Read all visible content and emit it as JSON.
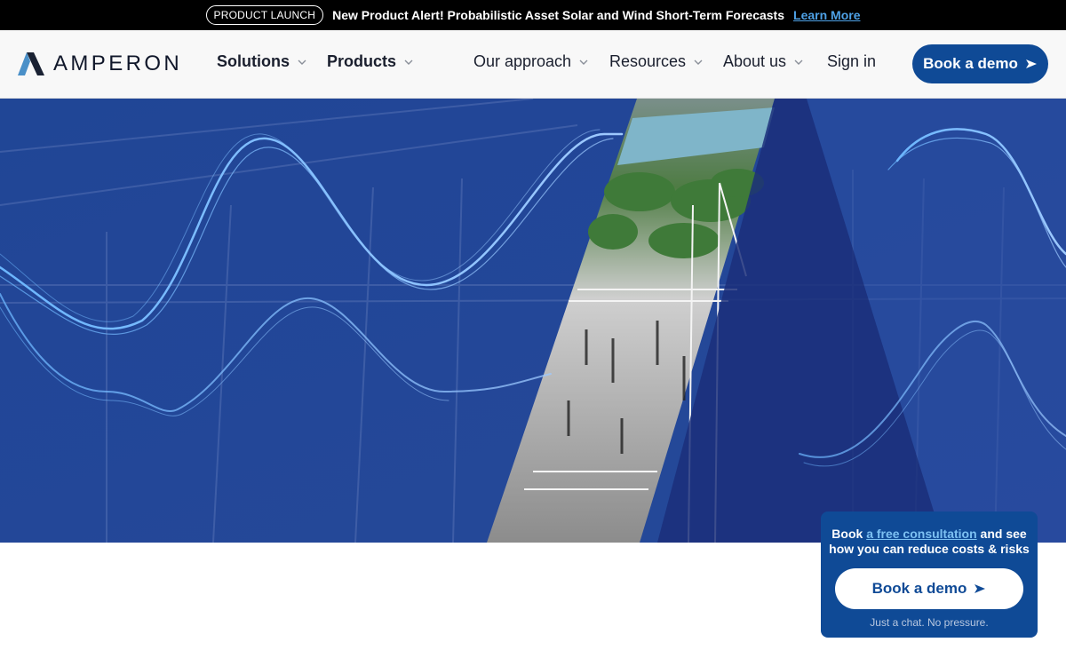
{
  "announcement": {
    "badge": "PRODUCT LAUNCH",
    "message": "New Product Alert! Probabilistic Asset Solar and Wind Short-Term Forecasts",
    "link": "Learn More"
  },
  "brand": {
    "name": "AMPERON",
    "logo_icon": "amperon-logo-icon"
  },
  "nav": {
    "solutions": "Solutions",
    "products": "Products",
    "approach": "Our approach",
    "resources": "Resources",
    "about": "About us",
    "signin": "Sign in",
    "demo": "Book a demo"
  },
  "card": {
    "prefix": "Book",
    "link": "a free consultation",
    "rest1": " and see",
    "line2": "how you can reduce costs & risks",
    "button": "Book a demo",
    "note": "Just a chat. No pressure."
  },
  "colors": {
    "accent": "#0f4a96",
    "hero_overlay": "#1f3f94",
    "link_light": "#7cc0f2",
    "announce_link": "#4ea1e6"
  }
}
